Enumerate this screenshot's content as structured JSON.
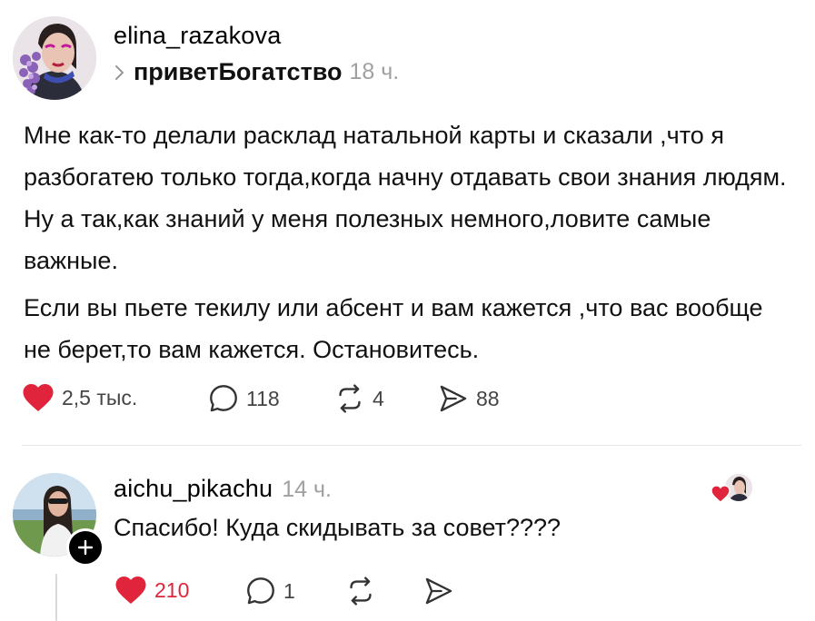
{
  "post": {
    "username": "elina_razakova",
    "community": "приветБогатство",
    "time": "18 ч.",
    "paragraphs": [
      "Мне как-то делали расклад натальной карты и сказали ,что я разбогатею только тогда,когда начну отдавать свои знания людям. Ну а так,как знаний у меня полезных немного,ловите самые важные.",
      "Если вы пьете текилу или абсент и вам кажется ,что вас вообще не берет,то вам кажется. Остановитесь."
    ],
    "likes": "2,5 тыс.",
    "replies": "118",
    "reposts": "4",
    "shares": "88"
  },
  "reply": {
    "username": "aichu_pikachu",
    "time": "14 ч.",
    "text": "Спасибо! Куда скидывать за совет????",
    "likes": "210",
    "replies": "1"
  },
  "colors": {
    "like": "#e0243b",
    "muted": "#a0a0a0",
    "text": "#111111"
  },
  "icons": [
    "heart-icon",
    "comment-icon",
    "repost-icon",
    "share-icon",
    "follow-plus-icon",
    "chevron-right-icon"
  ]
}
